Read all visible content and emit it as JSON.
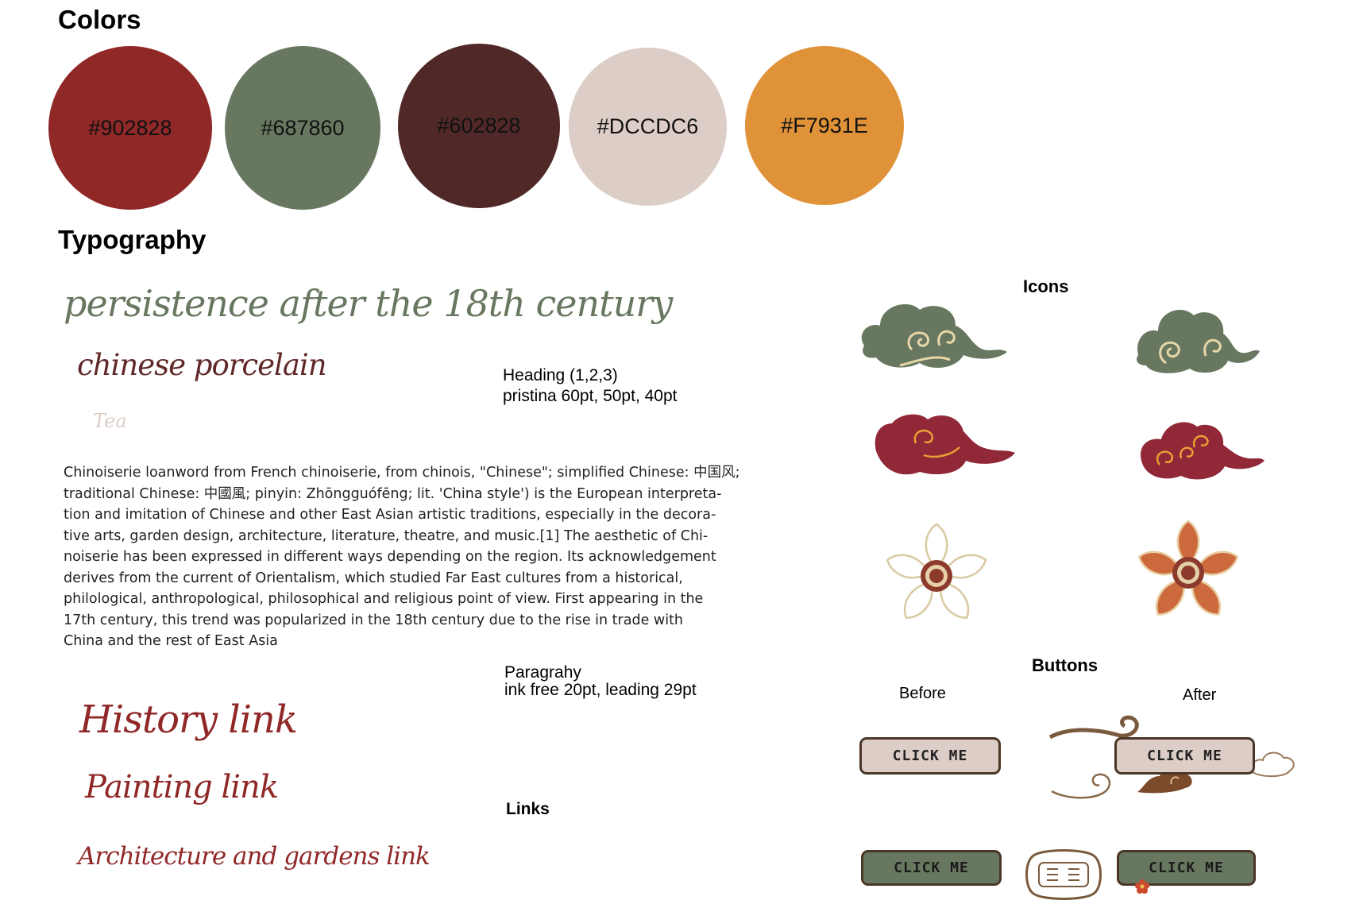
{
  "colors_section": {
    "title": "Colors",
    "swatches": [
      {
        "label": "#902828",
        "color": "#902828"
      },
      {
        "label": "#687860",
        "color": "#687860"
      },
      {
        "label": "#602828",
        "color": "#602828"
      },
      {
        "label": "#DCCDC6",
        "color": "#DCCDC6"
      },
      {
        "label": "#F7931E",
        "color": "#F7931E"
      }
    ]
  },
  "typography_section": {
    "title": "Typography",
    "heading1_sample": "persistence after the 18th century",
    "heading2_sample": "chinese porcelain",
    "heading3_sample": "Tea",
    "heading_caption_line1": "Heading (1,2,3)",
    "heading_caption_line2": "pristina 60pt, 50pt, 40pt",
    "paragraph_lines": [
      "Chinoiserie loanword from French chinoiserie, from chinois, \"Chinese\"; simplified Chinese: 中国风;",
      "traditional Chinese: 中國風; pinyin: Zhōngguófēng; lit. 'China style') is the European interpreta-",
      "tion and imitation of Chinese and other East Asian artistic traditions, especially in the decora-",
      "tive arts, garden design, architecture, literature, theatre, and music.[1] The aesthetic of Chi-",
      "noiserie has been expressed in different ways depending on the region. Its acknowledgement",
      "derives from the current of Orientalism, which studied Far East cultures from a historical,",
      "philological, anthropological, philosophical and religious point of view. First appearing in the",
      "17th century, this trend was popularized in the 18th century due to the rise in trade with",
      "China and the rest of East Asia"
    ],
    "paragraph_caption_line1": "Paragrahy",
    "paragraph_caption_line2": "ink free 20pt, leading 29pt",
    "links": [
      "History link",
      "Painting link",
      "Architecture and gardens link"
    ],
    "links_caption": "Links"
  },
  "icons_section": {
    "title": "Icons",
    "icons": [
      "cloud-green-icon",
      "cloud-red-icon",
      "flower-icon"
    ]
  },
  "buttons_section": {
    "title": "Buttons",
    "before_label": "Before",
    "after_label": "After",
    "button_text": "CLICK ME"
  }
}
